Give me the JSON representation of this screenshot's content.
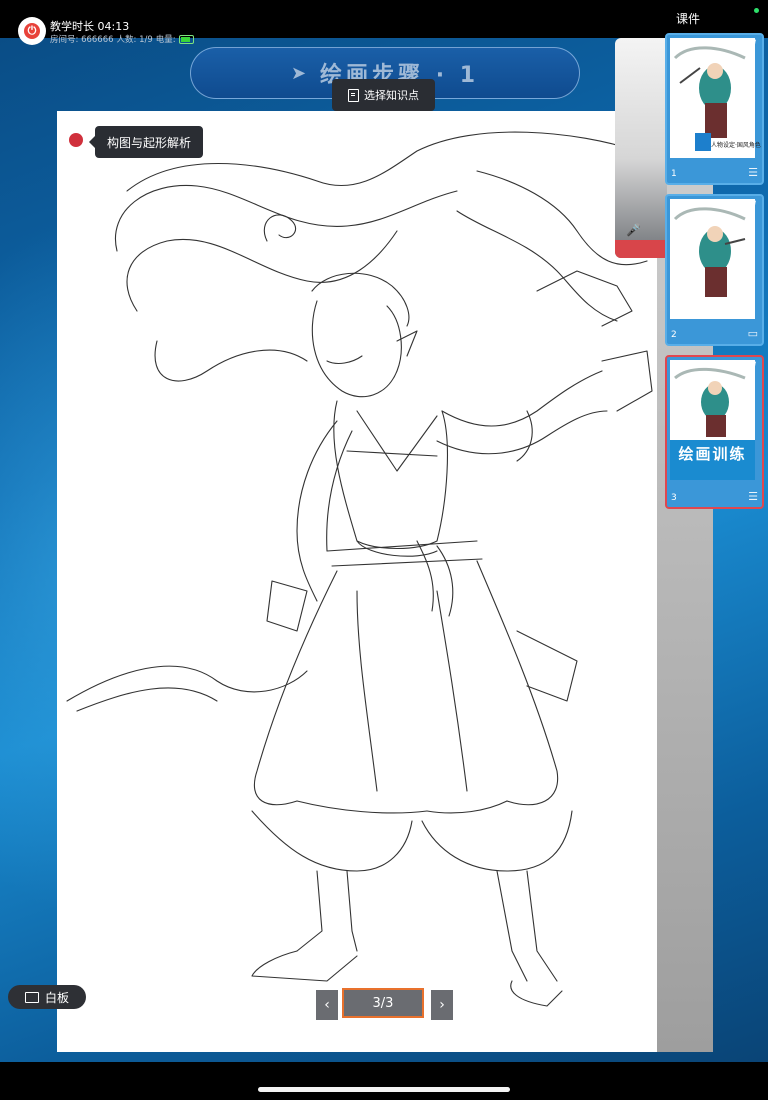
{
  "status": {
    "session_label": "教学时长",
    "session_time": "04:13",
    "room_label": "房间号: 666666",
    "people_label": "人数: 1/9",
    "battery_label": "电量:"
  },
  "step_banner": {
    "title": "绘画步骤 · 1",
    "knowledge_button": "选择知识点"
  },
  "annotation": {
    "label": "构图与起形解析"
  },
  "sidebar": {
    "title": "课件",
    "slides": [
      {
        "number": "1",
        "caption": "",
        "subtitle": "人物设定·国风角色",
        "icon": "layers-icon"
      },
      {
        "number": "2",
        "caption": "",
        "subtitle": "",
        "icon": "screen-icon"
      },
      {
        "number": "3",
        "caption": "绘画训练",
        "subtitle": "",
        "icon": "layers-icon",
        "active": true
      }
    ]
  },
  "whiteboard": {
    "label": "白板"
  },
  "pager": {
    "value": "3/3",
    "prev": "‹",
    "next": "›"
  },
  "colors": {
    "accent": "#e8712d",
    "active_border": "#e0474f",
    "record": "#d0303c"
  }
}
